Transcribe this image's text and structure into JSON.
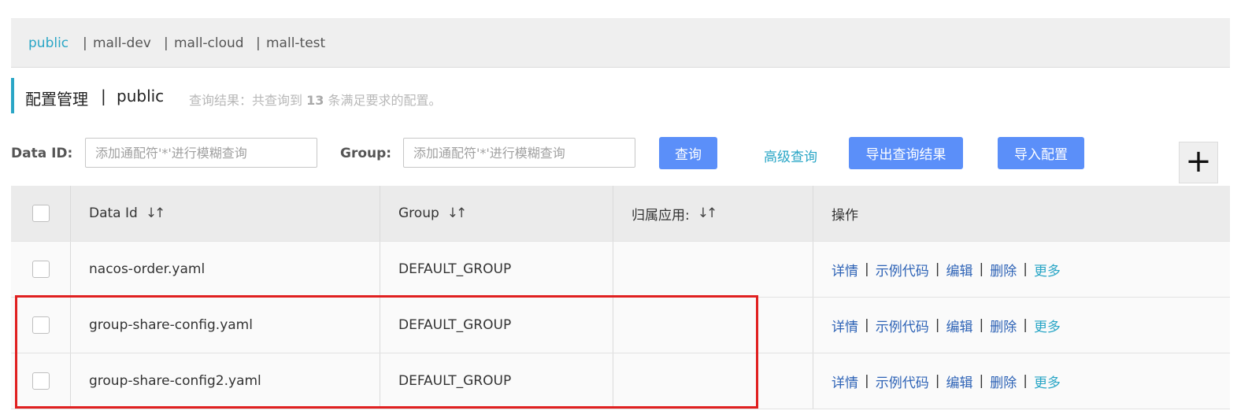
{
  "namespaces": {
    "items": [
      "public",
      "mall-dev",
      "mall-cloud",
      "mall-test"
    ],
    "separator": "|"
  },
  "header": {
    "title": "配置管理",
    "separator": "|",
    "namespace": "public",
    "result_prefix": "查询结果：共查询到",
    "result_count": "13",
    "result_suffix": "条满足要求的配置。"
  },
  "search": {
    "data_id_label": "Data ID:",
    "data_id_placeholder": "添加通配符'*'进行模糊查询",
    "data_id_value": "",
    "group_label": "Group:",
    "group_placeholder": "添加通配符'*'进行模糊查询",
    "group_value": "",
    "query_button": "查询",
    "advanced_link": "高级查询",
    "export_button": "导出查询结果",
    "import_button": "导入配置",
    "add_button": "+"
  },
  "table": {
    "columns": {
      "data_id": "Data Id",
      "group": "Group",
      "app": "归属应用:",
      "actions": "操作",
      "sort_icon": "↓↑"
    },
    "rows": [
      {
        "data_id": "nacos-order.yaml",
        "group": "DEFAULT_GROUP",
        "app": ""
      },
      {
        "data_id": "group-share-config.yaml",
        "group": "DEFAULT_GROUP",
        "app": ""
      },
      {
        "data_id": "group-share-config2.yaml",
        "group": "DEFAULT_GROUP",
        "app": ""
      }
    ],
    "actions": {
      "detail": "详情",
      "sample": "示例代码",
      "edit": "编辑",
      "delete": "删除",
      "more": "更多",
      "separator": "|"
    }
  },
  "colors": {
    "accent": "#2aa6c6",
    "primary_button": "#5b8ff9",
    "link": "#2e63b6",
    "highlight": "#e02020"
  },
  "icons": {
    "sort": "sort-icon",
    "add": "plus-icon",
    "checkbox": "checkbox"
  }
}
